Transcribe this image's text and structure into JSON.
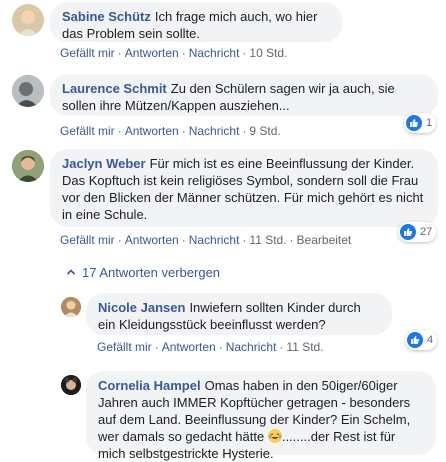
{
  "comments": [
    {
      "author": "Sabine Schütz",
      "text": "Ich frage mich auch, wo hier das Problem sein sollte.",
      "actions": {
        "like": "Gefällt mir",
        "reply": "Antworten",
        "message": "Nachricht",
        "time": "10 Std."
      }
    },
    {
      "author": "Laurence Schmit",
      "text": "Zu den Schülern sagen wir ja auch, sie sollen ihre Mützen/Kappen ausziehen...",
      "actions": {
        "like": "Gefällt mir",
        "reply": "Antworten",
        "message": "Nachricht",
        "time": "9 Std."
      },
      "reaction_count": "1"
    },
    {
      "author": "Jaclyn Weber",
      "text": "Für mich ist es eine Beeinflussung der Kinder. Das Kopftuch ist kein religiöses Symbol, sondern soll die Frau vor den Blicken der Männer schützen. Für mich gehört es nicht in eine Schule.",
      "actions": {
        "like": "Gefällt mir",
        "reply": "Antworten",
        "message": "Nachricht",
        "time": "11 Std.",
        "edited": "Bearbeitet"
      },
      "reaction_count": "27"
    }
  ],
  "replies_toggle": "17 Antworten verbergen",
  "replies": [
    {
      "author": "Nicole Jansen",
      "text": "Inwiefern sollten Kinder durch ein Kleidungsstück beeinflusst werden?",
      "actions": {
        "like": "Gefällt mir",
        "reply": "Antworten",
        "message": "Nachricht",
        "time": "11 Std."
      },
      "reaction_count": "4"
    },
    {
      "author": "Cornelia Hampel",
      "text_before_emoji": "Omas haben in den 50iger/60iger Jahren auch IMMER Kopftücher getragen - besonders auf dem Land. Beeinflussung der Kinder? Ein Schelm, wer damals so gedacht hätte ",
      "text_after_emoji": "........der Rest ist für mich selbstgestrickte Hysterie."
    }
  ],
  "colors": {
    "link": "#385898",
    "bubble": "#f2f3f5",
    "like_blue": "#1877f2",
    "meta": "#606770"
  }
}
